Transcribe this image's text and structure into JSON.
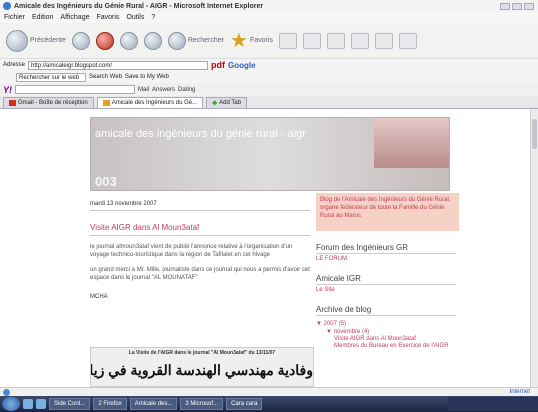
{
  "window": {
    "title": "Amicale des Ingénieurs du Génie Rural - AIGR - Microsoft Internet Explorer"
  },
  "menu": {
    "items": [
      "Fichier",
      "Edition",
      "Affichage",
      "Favoris",
      "Outils",
      "?"
    ]
  },
  "nav": {
    "back_label": "Précédente",
    "search_label": "Rechercher",
    "favorites_label": "Favoris"
  },
  "address": {
    "label": "Adresse",
    "url": "http://amicaleigr.blogspot.com/",
    "pdf_label": "pdf",
    "google_label": "Google"
  },
  "search_bar": {
    "field_text": "Rechercher sur le web",
    "search_web_label": "Search Web",
    "save_label": "Save to My Web",
    "mail_label": "Mail",
    "answers_label": "Answers",
    "dating_label": "Dating"
  },
  "tabs": [
    {
      "label": "Gmail - Boîte de réception"
    },
    {
      "label": "Amicale des Ingénieurs du Gé..."
    },
    {
      "label": "Add Tab"
    }
  ],
  "blog": {
    "title": "amicale des ingénieurs du génie rural - aigr",
    "header_number": "003",
    "post": {
      "date": "mardi 13 novembre 2007",
      "title": "Visite AIGR dans Al Moun3ataf",
      "para1": "le journal almoun3ataf vient de publié l'annonce relative à l'organisation d'un voyage technico-touristique dans la région de Tafilalet en cet hivage",
      "para2": "un grand merci à Mr. Mille, journaliste dans ce journal qui nous a permis d'avoir cet espace dans le journal \"AL MOUNATAF\"",
      "mcha": "MCHA",
      "clip_caption": "La Visite de l'AIGR dans le journal \"Al Moun3ataf\" du 13/11/07",
      "clip_headline": "وفادية مهندسي الهندسة القروية في زيارة لتافيلالت"
    },
    "sidebar": {
      "promo": "Blog de l'Amicale des Ingénieurs du Génie Rural, organe fédérateur de toute la Famille du Génie Rural au Maroc",
      "forum_heading": "Forum des Ingénieurs GR",
      "forum_link": "LE FORUM",
      "site_heading": "Amicale IGR",
      "site_link": "Le Site",
      "archive_heading": "Archive de blog",
      "archive_year": "▼ 2007 (5)",
      "archive_month": "▼ novembre (4)",
      "archive_post1": "Visite AIGR dans Al Moun3ataf",
      "archive_post2": "Membres du Bureau en Exercice de l'AIGR"
    }
  },
  "status": {
    "zone": "Internet"
  },
  "taskbar": {
    "buttons": [
      "Side Cont...",
      "2 Firefox",
      "Amicale des...",
      "3 Microsof...",
      "Cara cara"
    ]
  }
}
